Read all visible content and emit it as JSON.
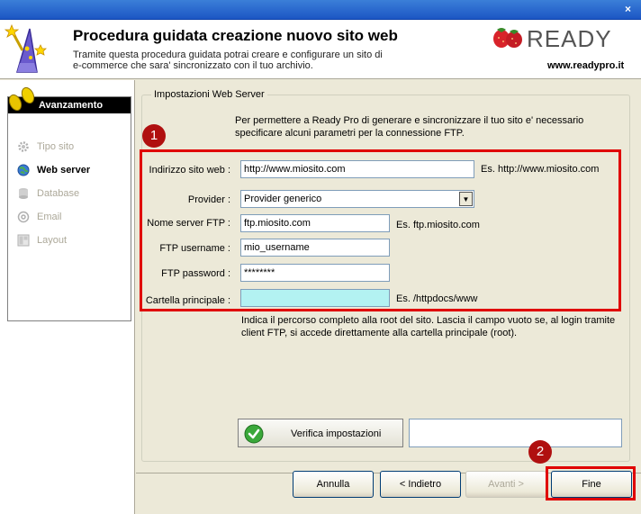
{
  "window": {
    "close_label": "×"
  },
  "header": {
    "title": "Procedura guidata creazione nuovo sito web",
    "desc_line1": "Tramite questa procedura guidata potrai creare e configurare un sito di",
    "desc_line2": "e-commerce che sara' sincronizzato con il tuo archivio.",
    "logo_text": "READY",
    "url": "www.readypro.it"
  },
  "nav": {
    "header": "Avanzamento",
    "items": [
      {
        "label": "Tipo sito",
        "state": "disabled",
        "icon": "gear-icon"
      },
      {
        "label": "Web server",
        "state": "active",
        "icon": "globe-icon"
      },
      {
        "label": "Database",
        "state": "disabled",
        "icon": "database-icon"
      },
      {
        "label": "Email",
        "state": "disabled",
        "icon": "at-icon"
      },
      {
        "label": "Layout",
        "state": "disabled",
        "icon": "layout-icon"
      }
    ]
  },
  "main": {
    "group_title": "Impostazioni Web Server",
    "intro_line1": "Per permettere a Ready Pro di generare e sincronizzare il tuo sito e' necessario",
    "intro_line2": "specificare alcuni parametri per la connessione FTP.",
    "fields": {
      "site_address": {
        "label": "Indirizzo sito web :",
        "value": "http://www.miosito.com",
        "hint": "Es. http://www.miosito.com"
      },
      "provider": {
        "label": "Provider :",
        "value": "Provider generico"
      },
      "ftp_server": {
        "label": "Nome server FTP :",
        "value": "ftp.miosito.com",
        "hint": "Es. ftp.miosito.com"
      },
      "ftp_username": {
        "label": "FTP username :",
        "value": "mio_username"
      },
      "ftp_password": {
        "label": "FTP password :",
        "value": "********"
      },
      "main_folder": {
        "label": "Cartella principale :",
        "value": "",
        "hint": "Es. /httpdocs/www"
      }
    },
    "note_line1": "Indica il percorso completo alla root del sito. Lascia il campo vuoto se, al login tramite",
    "note_line2": "client FTP, si accede direttamente alla cartella principale (root).",
    "verify_label": "Verifica impostazioni",
    "verify_result": ""
  },
  "annotations": {
    "badge1": "1",
    "badge2": "2",
    "highlight_color": "#e00000"
  },
  "buttons": {
    "cancel": "Annulla",
    "back": "< Indietro",
    "next": "Avanti >",
    "finish": "Fine"
  }
}
